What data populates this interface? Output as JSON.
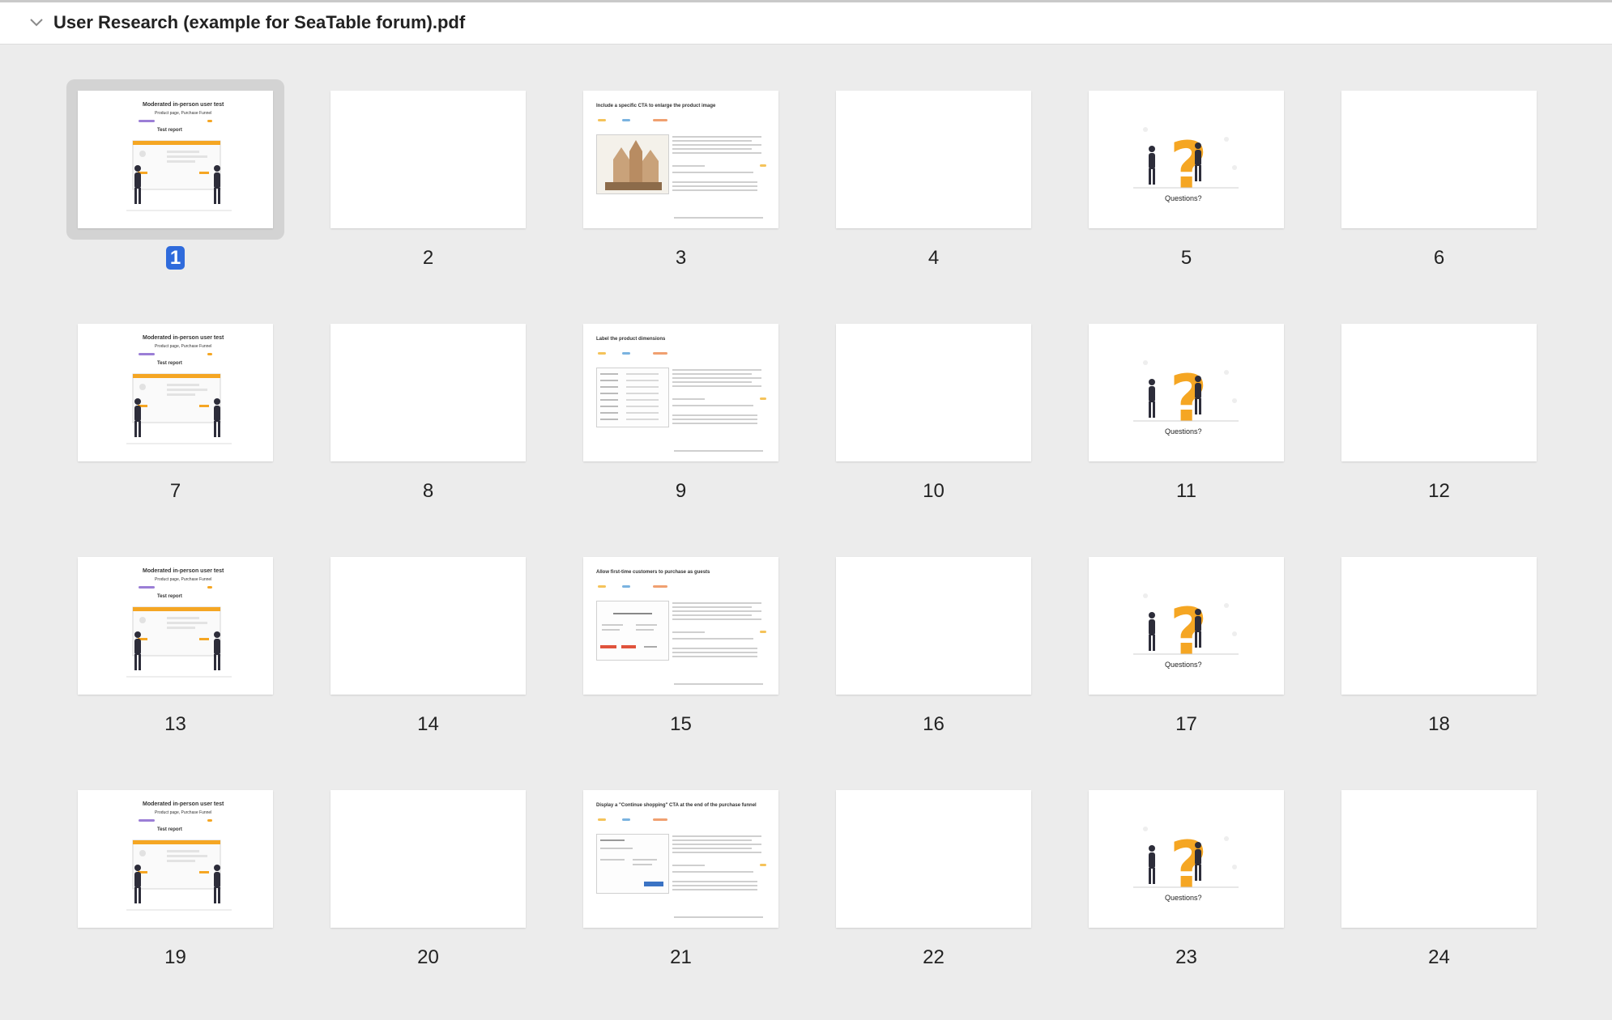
{
  "window": {
    "title": "User Research (example for SeaTable forum).pdf"
  },
  "selected_page": "1",
  "colors": {
    "selection": "#2f6bdc",
    "accent_orange": "#f5a623",
    "accent_purple": "#9b7ed6"
  },
  "pages": [
    {
      "num": "1",
      "type": "test-report"
    },
    {
      "num": "2",
      "type": "blank"
    },
    {
      "num": "3",
      "type": "finding-image"
    },
    {
      "num": "4",
      "type": "blank"
    },
    {
      "num": "5",
      "type": "questions"
    },
    {
      "num": "6",
      "type": "blank"
    },
    {
      "num": "7",
      "type": "test-report"
    },
    {
      "num": "8",
      "type": "blank"
    },
    {
      "num": "9",
      "type": "finding-table"
    },
    {
      "num": "10",
      "type": "blank"
    },
    {
      "num": "11",
      "type": "questions"
    },
    {
      "num": "12",
      "type": "blank"
    },
    {
      "num": "13",
      "type": "test-report"
    },
    {
      "num": "14",
      "type": "blank"
    },
    {
      "num": "15",
      "type": "finding-form"
    },
    {
      "num": "16",
      "type": "blank"
    },
    {
      "num": "17",
      "type": "questions"
    },
    {
      "num": "18",
      "type": "blank"
    },
    {
      "num": "19",
      "type": "test-report"
    },
    {
      "num": "20",
      "type": "blank"
    },
    {
      "num": "21",
      "type": "finding-checkout"
    },
    {
      "num": "22",
      "type": "blank"
    },
    {
      "num": "23",
      "type": "questions"
    },
    {
      "num": "24",
      "type": "blank"
    }
  ],
  "thumb_text": {
    "report_title": "Moderated in-person user test",
    "report_subtitle": "Product page, Purchase Funnel",
    "report_label": "Test report",
    "questions_caption": "Questions?",
    "finding_titles": {
      "3": "Include a specific CTA to enlarge the product image",
      "9": "Label the product dimensions",
      "15": "Allow first-time customers to purchase as guests",
      "21": "Display a \"Continue shopping\" CTA at the end of the purchase funnel"
    }
  }
}
